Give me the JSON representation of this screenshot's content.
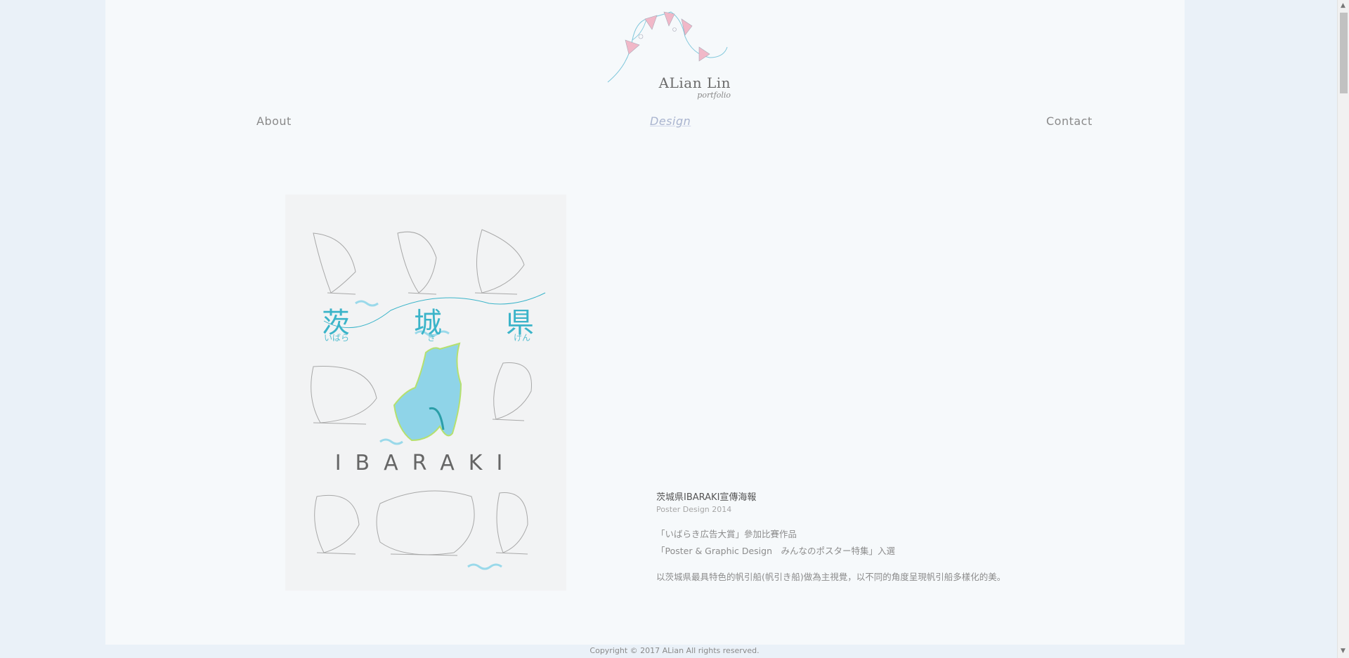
{
  "logo": {
    "name": "ALian Lin",
    "subtitle": "portfolio",
    "flag_color": "#f1b8c8",
    "line_color": "#7fc7db"
  },
  "nav": {
    "about": "About",
    "design": "Design",
    "contact": "Contact"
  },
  "poster": {
    "kanji": [
      "茨",
      "城",
      "県"
    ],
    "kana": [
      "いばら",
      "き",
      "けん"
    ],
    "latin": "IBARAKI",
    "accent_color": "#3bb4c9",
    "map_color": "#8fd4e8"
  },
  "work": {
    "title": "茨城県IBARAKI宣傳海報",
    "subtitle": "Poster Design 2014",
    "award_1": "「いばらき広告大賞」參加比賽作品",
    "award_2": "「Poster & Graphic Design　みんなのポスター特集」入選",
    "description": "以茨城県最具特色的帆引船(帆引き船)做為主視覺，以不同的角度呈現帆引船多樣化的美。"
  },
  "footer": {
    "copyright": "Copyright © 2017 ALian All rights reserved."
  }
}
